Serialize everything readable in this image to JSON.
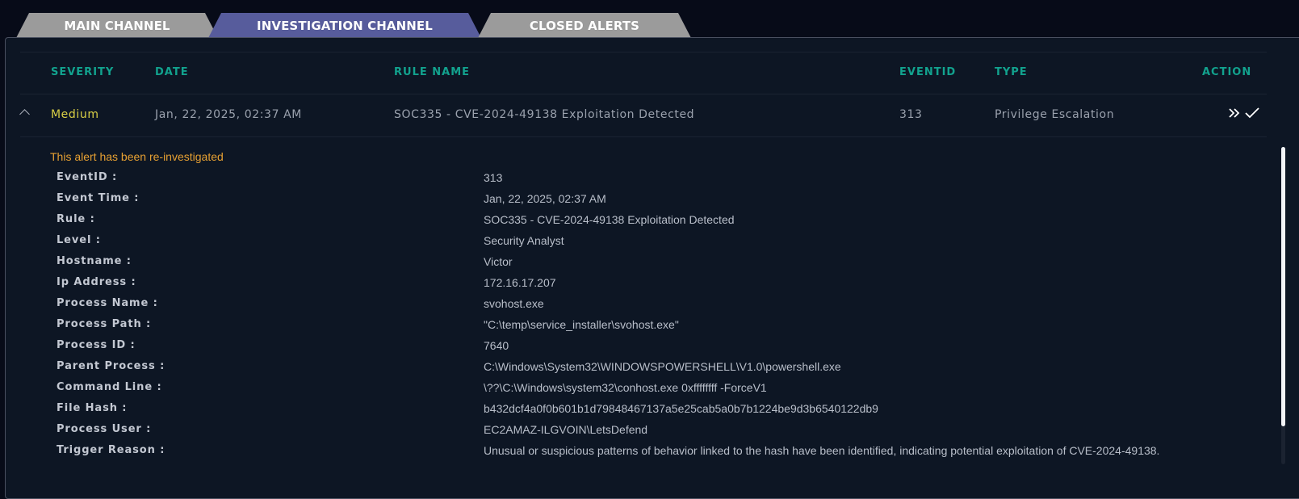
{
  "tabs": [
    {
      "label": "MAIN CHANNEL",
      "active": false
    },
    {
      "label": "INVESTIGATION CHANNEL",
      "active": true
    },
    {
      "label": "CLOSED ALERTS",
      "active": false
    }
  ],
  "table": {
    "headers": {
      "severity": "SEVERITY",
      "date": "DATE",
      "rule_name": "RULE NAME",
      "eventid": "EVENTID",
      "type": "TYPE",
      "action": "ACTION"
    },
    "row": {
      "severity": "Medium",
      "date": "Jan, 22, 2025, 02:37 AM",
      "rule_name": "SOC335 - CVE-2024-49138 Exploitation Detected",
      "eventid": "313",
      "type": "Privilege Escalation",
      "actions": [
        "forward-icon",
        "check-icon"
      ]
    }
  },
  "details": {
    "note": "This alert has been re-investigated",
    "fields": [
      {
        "label": "EventID :",
        "value": "313"
      },
      {
        "label": "Event Time :",
        "value": "Jan, 22, 2025, 02:37 AM"
      },
      {
        "label": "Rule :",
        "value": "SOC335 - CVE-2024-49138 Exploitation Detected"
      },
      {
        "label": "Level :",
        "value": "Security Analyst"
      },
      {
        "label": "Hostname :",
        "value": "Victor"
      },
      {
        "label": "Ip Address :",
        "value": "172.16.17.207"
      },
      {
        "label": "Process Name :",
        "value": "svohost.exe"
      },
      {
        "label": "Process Path :",
        "value": "\"C:\\temp\\service_installer\\svohost.exe\""
      },
      {
        "label": "Process ID :",
        "value": "7640"
      },
      {
        "label": "Parent Process :",
        "value": "C:\\Windows\\System32\\WINDOWSPOWERSHELL\\V1.0\\powershell.exe"
      },
      {
        "label": "Command Line :",
        "value": "\\??\\C:\\Windows\\system32\\conhost.exe 0xffffffff -ForceV1"
      },
      {
        "label": "File Hash :",
        "value": "b432dcf4a0f0b601b1d79848467137a5e25cab5a0b7b1224be9d3b6540122db9"
      },
      {
        "label": "Process User :",
        "value": "EC2AMAZ-ILGVOIN\\LetsDefend"
      },
      {
        "label": "Trigger Reason :",
        "value": "Unusual or suspicious patterns of behavior linked to the hash have been identified, indicating potential exploitation of CVE-2024-49138."
      }
    ]
  },
  "colors": {
    "accent_header": "#12a28e",
    "severity_medium": "#d9cf46",
    "note": "#e6a032",
    "active_tab": "#575c9c",
    "inactive_tab": "#9b9b9b"
  }
}
